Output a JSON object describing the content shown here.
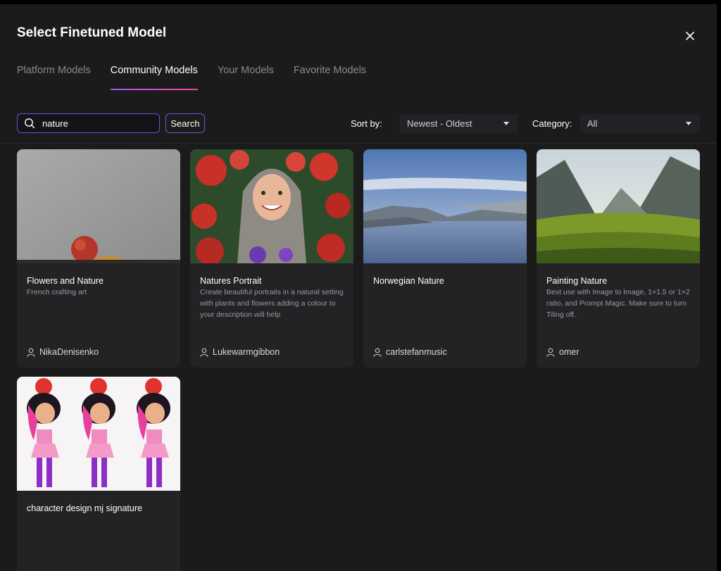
{
  "dialog": {
    "title": "Select Finetuned Model"
  },
  "tabs": [
    {
      "label": "Platform Models",
      "active": false
    },
    {
      "label": "Community Models",
      "active": true
    },
    {
      "label": "Your Models",
      "active": false
    },
    {
      "label": "Favorite Models",
      "active": false
    }
  ],
  "search": {
    "value": "nature",
    "button_label": "Search"
  },
  "sort": {
    "label": "Sort by:",
    "value": "Newest - Oldest"
  },
  "category": {
    "label": "Category:",
    "value": "All"
  },
  "models": [
    {
      "name": "Flowers and Nature",
      "description": "French crafting art",
      "author": "NikaDenisenko"
    },
    {
      "name": "Natures Portrait",
      "description": "Create beautiful portraits in a natural setting with plants and flowers adding a colour to your description will help",
      "author": "Lukewarmgibbon"
    },
    {
      "name": "Norwegian Nature",
      "description": "",
      "author": "carlstefanmusic"
    },
    {
      "name": "Painting Nature",
      "description": "Best use with Image to Image, 1×1.5 or 1×2 ratio, and Prompt Magic. Make sure to turn Tiling off.",
      "author": "omer"
    },
    {
      "name": "character design mj signature",
      "description": "",
      "author": ""
    }
  ],
  "colors": {
    "accent": "#7b4fd9",
    "background": "#1b1b1c",
    "card": "#232325"
  }
}
